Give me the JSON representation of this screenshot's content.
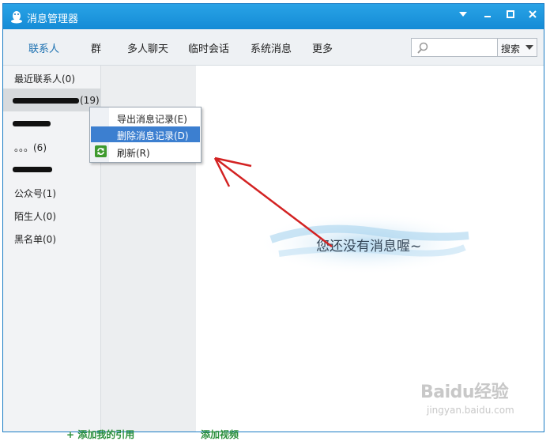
{
  "window": {
    "title": "消息管理器"
  },
  "tabs": [
    {
      "label": "联系人",
      "active": true
    },
    {
      "label": "群"
    },
    {
      "label": "多人聊天"
    },
    {
      "label": "临时会话"
    },
    {
      "label": "系统消息"
    },
    {
      "label": "更多"
    }
  ],
  "search": {
    "value": "",
    "button_label": "搜索"
  },
  "sidebar": {
    "items": [
      {
        "label": "最近联系人(0)"
      },
      {
        "label": "(19)"
      },
      {
        "label": ""
      },
      {
        "label": "。。。(6)"
      },
      {
        "label": ""
      },
      {
        "label": "公众号(1)"
      },
      {
        "label": "陌生人(0)"
      },
      {
        "label": "黑名单(0)"
      }
    ]
  },
  "context_menu": {
    "items": [
      {
        "label": "导出消息记录(E)"
      },
      {
        "label": "删除消息记录(D)",
        "highlighted": true
      },
      {
        "label": "刷新(R)",
        "icon": "refresh-icon"
      }
    ]
  },
  "content": {
    "empty_text": "您还没有消息喔~"
  },
  "background_strip": {
    "left_text": "+ 添加我的引用",
    "right_text": "添加视频"
  },
  "watermark": {
    "text": "Baidu经验",
    "sub": "jingyan.baidu.com"
  },
  "colors": {
    "titlebar": "#1a94dd",
    "highlight": "#3c7fd0",
    "arrow": "#d32222"
  }
}
